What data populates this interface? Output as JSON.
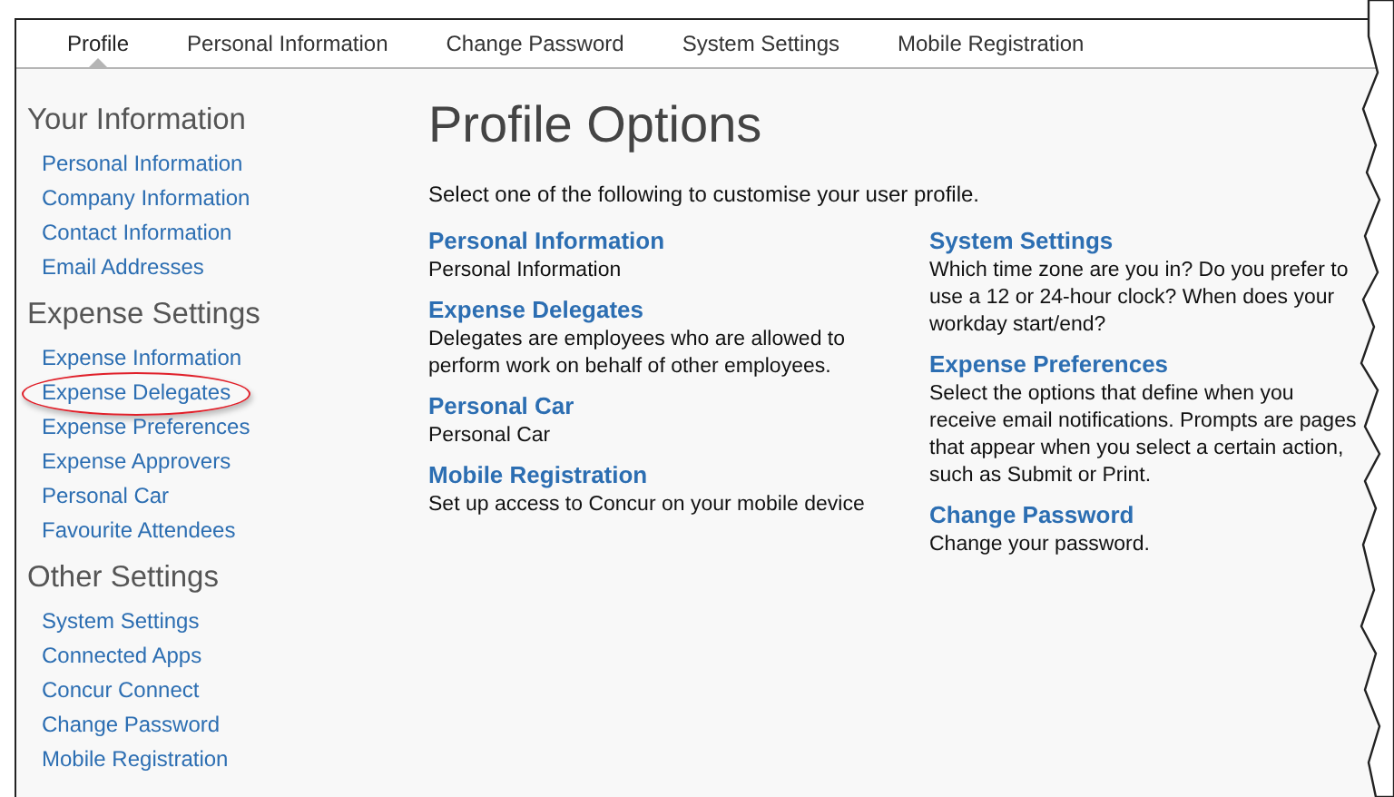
{
  "tabs": [
    {
      "label": "Profile",
      "selected": true
    },
    {
      "label": "Personal Information",
      "selected": false
    },
    {
      "label": "Change Password",
      "selected": false
    },
    {
      "label": "System Settings",
      "selected": false
    },
    {
      "label": "Mobile Registration",
      "selected": false
    }
  ],
  "sidebar": {
    "sections": [
      {
        "heading": "Your Information",
        "items": [
          {
            "label": "Personal Information",
            "highlighted": false
          },
          {
            "label": "Company Information",
            "highlighted": false
          },
          {
            "label": "Contact Information",
            "highlighted": false
          },
          {
            "label": "Email Addresses",
            "highlighted": false
          }
        ]
      },
      {
        "heading": "Expense Settings",
        "items": [
          {
            "label": "Expense Information",
            "highlighted": false
          },
          {
            "label": "Expense Delegates",
            "highlighted": true
          },
          {
            "label": "Expense Preferences",
            "highlighted": false
          },
          {
            "label": "Expense Approvers",
            "highlighted": false
          },
          {
            "label": "Personal Car",
            "highlighted": false
          },
          {
            "label": "Favourite Attendees",
            "highlighted": false
          }
        ]
      },
      {
        "heading": "Other Settings",
        "items": [
          {
            "label": "System Settings",
            "highlighted": false
          },
          {
            "label": "Connected Apps",
            "highlighted": false
          },
          {
            "label": "Concur Connect",
            "highlighted": false
          },
          {
            "label": "Change Password",
            "highlighted": false
          },
          {
            "label": "Mobile Registration",
            "highlighted": false
          }
        ]
      }
    ]
  },
  "main": {
    "title": "Profile Options",
    "intro": "Select one of the following to customise your user profile.",
    "columns": [
      [
        {
          "title": "Personal Information",
          "description": "Personal Information"
        },
        {
          "title": "Expense Delegates",
          "description": "Delegates are employees who are allowed to perform work on behalf of other employees."
        },
        {
          "title": "Personal Car",
          "description": "Personal Car"
        },
        {
          "title": "Mobile Registration",
          "description": "Set up access to Concur on your mobile device"
        }
      ],
      [
        {
          "title": "System Settings",
          "description": "Which time zone are you in? Do you prefer to use a 12 or 24-hour clock? When does your workday start/end?"
        },
        {
          "title": "Expense Preferences",
          "description": "Select the options that define when you receive email notifications. Prompts are pages that appear when you select a certain action, such as Submit or Print."
        },
        {
          "title": "Change Password",
          "description": "Change your password."
        }
      ]
    ]
  }
}
